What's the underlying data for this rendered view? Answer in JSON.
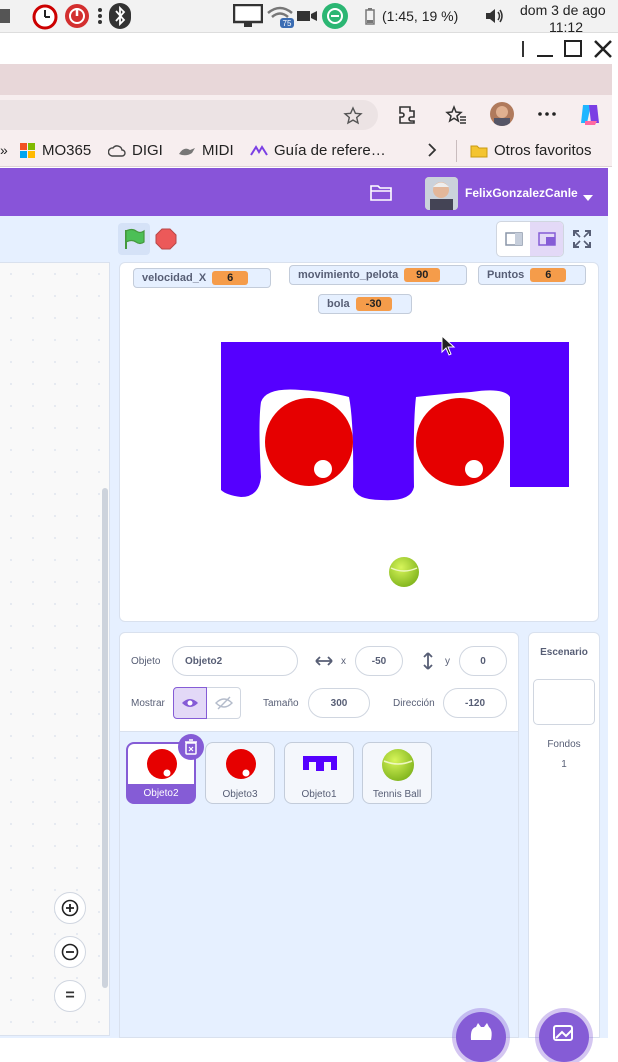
{
  "system": {
    "battery": "(1:45, 19 %)",
    "date": "dom  3 de ago",
    "time": "11:12",
    "network_badge": "75"
  },
  "bookmarks": {
    "items": [
      {
        "label": "MO365",
        "icon": "microsoft-icon"
      },
      {
        "label": "DIGI",
        "icon": "cloud-icon"
      },
      {
        "label": "MIDI",
        "icon": "bird-icon"
      },
      {
        "label": "Guía de refere…",
        "icon": "logo-icon"
      }
    ],
    "others": "Otros favoritos"
  },
  "menubar": {
    "username": "FelixGonzalezCanle"
  },
  "monitors": [
    {
      "label": "velocidad_X",
      "value": "6"
    },
    {
      "label": "movimiento_pelota",
      "value": "90"
    },
    {
      "label": "Puntos",
      "value": "6"
    },
    {
      "label": "bola",
      "value": "-30"
    }
  ],
  "sprite_info": {
    "objeto_label": "Objeto",
    "objeto_value": "Objeto2",
    "x_label": "x",
    "x_value": "-50",
    "y_label": "y",
    "y_value": "0",
    "mostrar_label": "Mostrar",
    "tamano_label": "Tamaño",
    "tamano_value": "300",
    "direccion_label": "Dirección",
    "direccion_value": "-120"
  },
  "sprites": [
    {
      "name": "Objeto2",
      "selected": true
    },
    {
      "name": "Objeto3",
      "selected": false
    },
    {
      "name": "Objeto1",
      "selected": false
    },
    {
      "name": "Tennis Ball",
      "selected": false
    }
  ],
  "stage_panel": {
    "title": "Escenario",
    "backdrops_label": "Fondos",
    "backdrops_count": "1"
  },
  "zoom": {
    "in": "+",
    "out": "−",
    "reset": "="
  },
  "colors": {
    "scratch_purple": "#8854d9",
    "paddle_blue": "#5500ff",
    "ball_red": "#e60000",
    "monitor_orange": "#f59c4a",
    "tennis_green": "#a5d62a"
  }
}
